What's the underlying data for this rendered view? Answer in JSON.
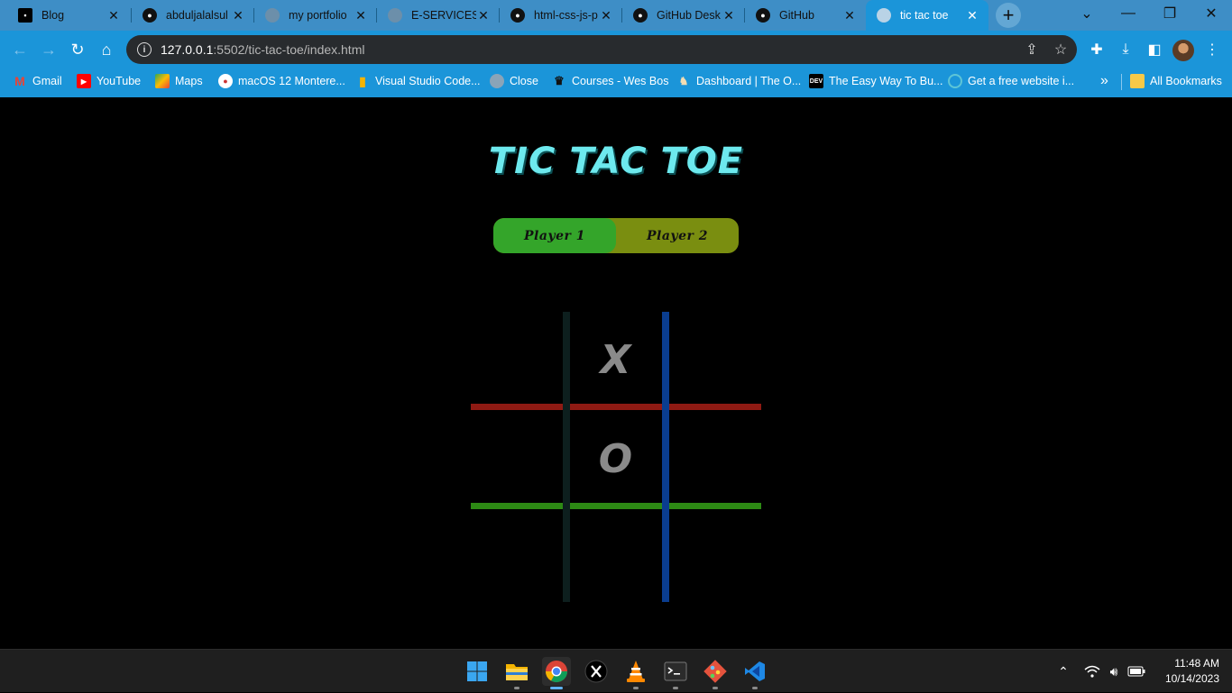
{
  "browser": {
    "tabs": [
      {
        "title": "Blog",
        "icon": "blog-favicon"
      },
      {
        "title": "abduljalalsul",
        "icon": "github-icon"
      },
      {
        "title": "my portfolio",
        "icon": "globe-icon"
      },
      {
        "title": "E-SERVICES.",
        "icon": "globe-icon"
      },
      {
        "title": "html-css-js-p",
        "icon": "github-icon"
      },
      {
        "title": "GitHub Desk",
        "icon": "github-icon"
      },
      {
        "title": "GitHub",
        "icon": "github-icon"
      },
      {
        "title": "tic tac toe",
        "icon": "globe-icon",
        "active": true
      }
    ],
    "url_host": "127.0.0.1",
    "url_rest": ":5502/tic-tac-toe/index.html",
    "bookmarks": [
      {
        "label": "Gmail",
        "icon": "gmail-icon"
      },
      {
        "label": "YouTube",
        "icon": "youtube-icon"
      },
      {
        "label": "Maps",
        "icon": "maps-icon"
      },
      {
        "label": "macOS 12 Montere...",
        "icon": "macos-icon"
      },
      {
        "label": "Visual Studio Code...",
        "icon": "bookmark-icon"
      },
      {
        "label": "Close",
        "icon": "globe-icon"
      },
      {
        "label": "Courses - Wes Bos",
        "icon": "crown-icon"
      },
      {
        "label": "Dashboard | The O...",
        "icon": "odin-icon"
      },
      {
        "label": "The Easy Way To Bu...",
        "icon": "dev-icon"
      },
      {
        "label": "Get a free website i...",
        "icon": "spiral-icon"
      }
    ],
    "more_bookmarks": "»",
    "all_bookmarks": "All Bookmarks",
    "accent_color": "#1b95d9"
  },
  "game": {
    "title": "TIC TAC TOE",
    "player1": "Player 1",
    "player2": "Player 2",
    "active_player": "Player 1",
    "cells": [
      "",
      "X",
      "",
      "",
      "O",
      "",
      "",
      "",
      ""
    ],
    "colors": {
      "title": "#6de9ee",
      "player1_bg": "#34a52a",
      "player2_bg": "#7a8e10",
      "line_v1": "#0d1f1e",
      "line_v2": "#0a3d8f",
      "line_h1": "#8f1a13",
      "line_h2": "#2d8a14",
      "mark": "#8a8a8a"
    }
  },
  "taskbar": {
    "apps": [
      {
        "name": "windows-start-icon"
      },
      {
        "name": "file-explorer-icon"
      },
      {
        "name": "chrome-icon",
        "active": true
      },
      {
        "name": "x-app-icon"
      },
      {
        "name": "vlc-icon"
      },
      {
        "name": "terminal-icon"
      },
      {
        "name": "git-icon"
      },
      {
        "name": "vscode-icon"
      }
    ],
    "time": "11:48 AM",
    "date": "10/14/2023"
  }
}
